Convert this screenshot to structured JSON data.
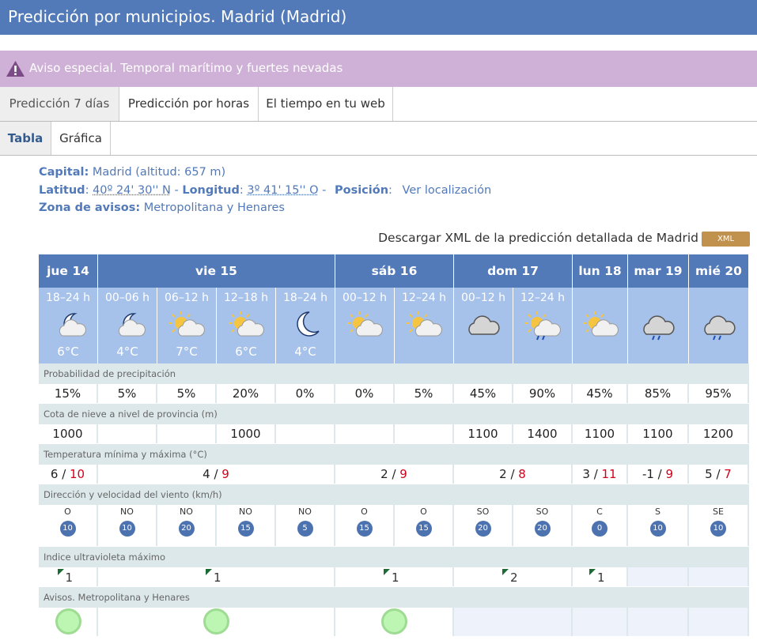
{
  "header": {
    "title": "Predicción por municipios. Madrid (Madrid)"
  },
  "alert": {
    "text": "Aviso especial. Temporal marítimo y fuertes nevadas",
    "icon": "warning-icon",
    "color": "#cfb0d6"
  },
  "tabs": [
    "Predicción 7 días",
    "Predicción por horas",
    "El tiempo en tu web"
  ],
  "subtabs": [
    "Tabla",
    "Gráfica"
  ],
  "info": {
    "capital_label": "Capital:",
    "capital_value": "Madrid (altitud: 657 m)",
    "lat_label": "Latitud",
    "lat_value": "40º 24' 30'' N",
    "lon_label": "Longitud",
    "lon_value": "3º 41' 15'' O",
    "pos_label": "Posición",
    "pos_link": "Ver localización",
    "zone_label": "Zona de avisos:",
    "zone_value": "Metropolitana y Henares"
  },
  "xml": {
    "text": "Descargar XML de la predicción detallada de Madrid",
    "button": "XML"
  },
  "days": [
    "jue 14",
    "vie 15",
    "sáb 16",
    "dom 17",
    "lun 18",
    "mar 19",
    "mié 20"
  ],
  "periods": [
    {
      "time": "18–24 h",
      "temp": "6°C",
      "icon": "moon-cloud-icon"
    },
    {
      "time": "00–06 h",
      "temp": "4°C",
      "icon": "moon-cloud-icon"
    },
    {
      "time": "06–12 h",
      "temp": "7°C",
      "icon": "sun-cloud-icon"
    },
    {
      "time": "12–18 h",
      "temp": "6°C",
      "icon": "sun-cloud-icon"
    },
    {
      "time": "18–24 h",
      "temp": "4°C",
      "icon": "moon-icon"
    },
    {
      "time": "00–12 h",
      "temp": "",
      "icon": "sun-cloud-icon"
    },
    {
      "time": "12–24 h",
      "temp": "",
      "icon": "sun-cloud-icon"
    },
    {
      "time": "00–12 h",
      "temp": "",
      "icon": "cloud-icon"
    },
    {
      "time": "12–24 h",
      "temp": "",
      "icon": "sun-cloud-rain-icon"
    },
    {
      "time": "",
      "temp": "",
      "icon": "sun-cloud-icon"
    },
    {
      "time": "",
      "temp": "",
      "icon": "cloud-rain-icon"
    },
    {
      "time": "",
      "temp": "",
      "icon": "cloud-rain-icon"
    }
  ],
  "rows": {
    "precip_label": "Probabilidad de precipitación",
    "precip": [
      "15%",
      "5%",
      "5%",
      "20%",
      "0%",
      "0%",
      "5%",
      "45%",
      "90%",
      "45%",
      "85%",
      "95%"
    ],
    "snow_label": "Cota de nieve a nivel de provincia (m)",
    "snow": [
      "1000",
      "",
      "",
      "1000",
      "",
      "",
      "",
      "1100",
      "1400",
      "1100",
      "1100",
      "1200"
    ],
    "temp_label": "Temperatura mínima y máxima (°C)",
    "temps": [
      {
        "min": "6",
        "max": "10"
      },
      {
        "min": "4",
        "max": "9"
      },
      {
        "min": "2",
        "max": "9"
      },
      {
        "min": "2",
        "max": "8"
      },
      {
        "min": "3",
        "max": "11"
      },
      {
        "min": "-1",
        "max": "9"
      },
      {
        "min": "5",
        "max": "7"
      }
    ],
    "wind_label": "Dirección y velocidad del viento (km/h)",
    "wind": [
      {
        "dir": "O",
        "speed": "10"
      },
      {
        "dir": "NO",
        "speed": "10"
      },
      {
        "dir": "NO",
        "speed": "20"
      },
      {
        "dir": "NO",
        "speed": "15"
      },
      {
        "dir": "NO",
        "speed": "5"
      },
      {
        "dir": "O",
        "speed": "15"
      },
      {
        "dir": "O",
        "speed": "15"
      },
      {
        "dir": "SO",
        "speed": "20"
      },
      {
        "dir": "SO",
        "speed": "20"
      },
      {
        "dir": "C",
        "speed": "0"
      },
      {
        "dir": "S",
        "speed": "10"
      },
      {
        "dir": "SE",
        "speed": "10"
      }
    ],
    "uv_label": "Indice ultravioleta máximo",
    "uv": [
      "1",
      "1",
      "1",
      "2",
      "1",
      "",
      ""
    ],
    "avisos_label": "Avisos. Metropolitana y Henares",
    "avisos": [
      "green",
      "green",
      "green",
      "",
      "",
      "",
      ""
    ]
  },
  "colors": {
    "header": "#5279b8",
    "accent_red": "#d0021b",
    "aviso_green": "#bdf5b2"
  }
}
